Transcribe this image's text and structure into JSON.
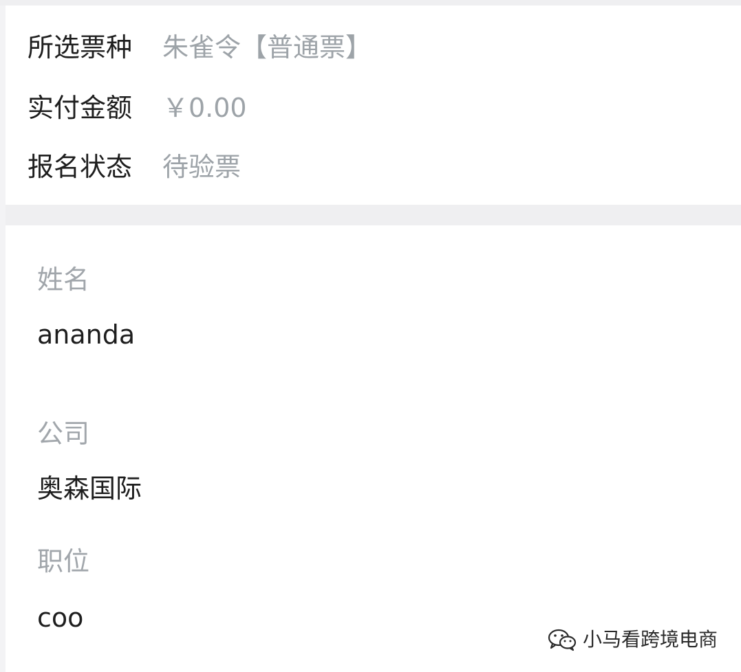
{
  "summary": {
    "ticket_type": {
      "label": "所选票种",
      "value": "朱雀令【普通票】"
    },
    "amount_paid": {
      "label": "实付金额",
      "value": "￥0.00"
    },
    "registration_status": {
      "label": "报名状态",
      "value": "待验票"
    }
  },
  "form": {
    "name": {
      "label": "姓名",
      "value": "ananda"
    },
    "company": {
      "label": "公司",
      "value": "奥森国际"
    },
    "position": {
      "label": "职位",
      "value": "coo"
    }
  },
  "watermark": {
    "icon": "wechat-icon",
    "text": "小马看跨境电商"
  },
  "colors": {
    "label_text": "#1e1e1e",
    "value_muted": "#9da3a8",
    "divider": "#efeff1",
    "background": "#ffffff"
  }
}
